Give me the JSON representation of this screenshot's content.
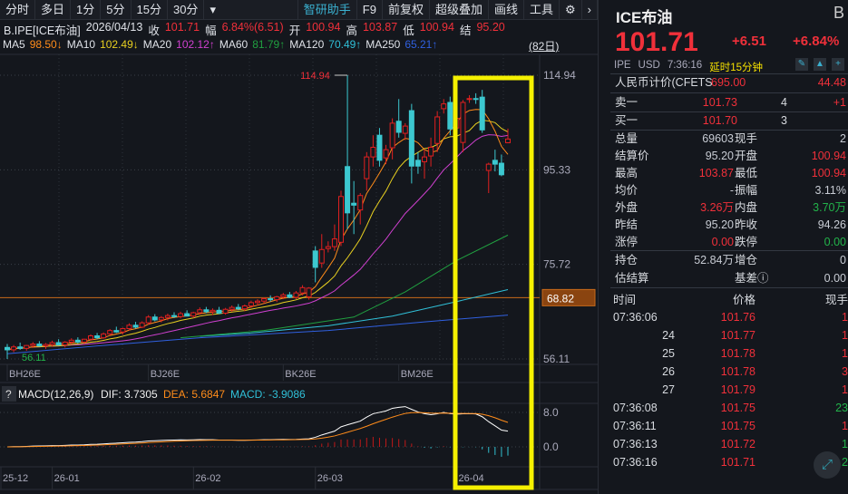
{
  "toolbar": {
    "tabs": [
      "分时",
      "多日",
      "1分",
      "5分",
      "15分",
      "30分"
    ],
    "dropdown": "▾",
    "assistant": "智研助手",
    "buttons": [
      "F9",
      "前复权",
      "超级叠加",
      "画线",
      "工具"
    ],
    "gear": "⚙",
    "next": "›"
  },
  "info": {
    "symbol": "B.IPE[ICE布油]",
    "date": "2026/04/13",
    "close_label": "收",
    "close": "101.71",
    "range_label": "幅",
    "range": "6.84%(6.51)",
    "open_label": "开",
    "open": "100.94",
    "high_label": "高",
    "high": "103.87",
    "low_label": "低",
    "low": "100.94",
    "settle_label": "结",
    "settle": "95.20"
  },
  "ma": [
    {
      "label": "MA5",
      "value": "98.50↓",
      "color": "#ff8c1a"
    },
    {
      "label": "MA10",
      "value": "102.49↓",
      "color": "#e8d020"
    },
    {
      "label": "MA20",
      "value": "102.12↑",
      "color": "#d040d0"
    },
    {
      "label": "MA60",
      "value": "81.79↑",
      "color": "#20a040"
    },
    {
      "label": "MA120",
      "value": "70.49↑",
      "color": "#30c0d8"
    },
    {
      "label": "MA250",
      "value": "65.21↑",
      "color": "#3060e0"
    }
  ],
  "days": "(82日)",
  "chart_data": {
    "type": "candlestick",
    "price_axis": {
      "ticks": [
        "114.94",
        "95.33",
        "75.72",
        "56.11"
      ],
      "range": [
        56.11,
        114.94
      ]
    },
    "max_label": "114.94",
    "min_label": "56.11",
    "ref_line": {
      "value": 68.82,
      "label": "68.82",
      "color": "#c86a1a"
    },
    "contract_labels": [
      {
        "label": "BH26E",
        "index": 0
      },
      {
        "label": "BJ26E",
        "index": 22
      },
      {
        "label": "BK26E",
        "index": 43
      },
      {
        "label": "BM26E",
        "index": 61
      }
    ],
    "date_labels": [
      {
        "label": "25-12",
        "index": 0
      },
      {
        "label": "26-01",
        "index": 8
      },
      {
        "label": "26-02",
        "index": 30
      },
      {
        "label": "26-03",
        "index": 49
      },
      {
        "label": "26-04",
        "index": 71
      }
    ],
    "up_color": "#e02020",
    "down_color": "#3cc8d0",
    "candles": [
      [
        58.5,
        59.2,
        56.11,
        58.0
      ],
      [
        58.0,
        59.0,
        57.5,
        58.6
      ],
      [
        58.6,
        59.5,
        58.0,
        58.3
      ],
      [
        58.3,
        59.0,
        57.8,
        58.9
      ],
      [
        58.9,
        59.6,
        58.4,
        59.2
      ],
      [
        59.2,
        59.8,
        58.7,
        58.8
      ],
      [
        58.8,
        59.4,
        58.2,
        59.1
      ],
      [
        59.1,
        59.9,
        58.6,
        59.5
      ],
      [
        59.5,
        60.2,
        59.0,
        59.0
      ],
      [
        59.0,
        59.8,
        58.5,
        59.6
      ],
      [
        59.6,
        60.4,
        59.1,
        60.0
      ],
      [
        60.0,
        60.6,
        59.3,
        59.6
      ],
      [
        59.6,
        60.3,
        59.2,
        60.2
      ],
      [
        60.2,
        61.2,
        59.9,
        60.9
      ],
      [
        60.9,
        61.5,
        60.2,
        60.5
      ],
      [
        60.5,
        61.6,
        60.3,
        61.3
      ],
      [
        61.3,
        62.3,
        61.0,
        62.0
      ],
      [
        62.0,
        62.8,
        61.5,
        61.7
      ],
      [
        61.7,
        62.6,
        61.2,
        62.4
      ],
      [
        62.4,
        63.5,
        62.0,
        63.1
      ],
      [
        63.1,
        63.8,
        62.4,
        62.7
      ],
      [
        62.7,
        63.9,
        62.5,
        63.6
      ],
      [
        63.6,
        65.2,
        63.2,
        64.8
      ],
      [
        64.8,
        65.4,
        63.9,
        64.2
      ],
      [
        64.2,
        65.0,
        63.7,
        64.7
      ],
      [
        64.7,
        65.5,
        64.1,
        65.1
      ],
      [
        65.1,
        65.8,
        64.6,
        64.9
      ],
      [
        64.9,
        65.9,
        64.5,
        65.5
      ],
      [
        65.5,
        66.2,
        64.9,
        65.0
      ],
      [
        65.0,
        65.9,
        64.6,
        65.7
      ],
      [
        65.7,
        66.8,
        65.3,
        66.3
      ],
      [
        66.3,
        66.9,
        65.6,
        65.9
      ],
      [
        65.9,
        66.6,
        65.2,
        66.2
      ],
      [
        66.2,
        66.9,
        65.4,
        65.6
      ],
      [
        65.6,
        66.7,
        65.3,
        66.4
      ],
      [
        66.4,
        67.2,
        65.9,
        66.8
      ],
      [
        66.8,
        67.5,
        66.2,
        66.5
      ],
      [
        66.5,
        67.4,
        66.0,
        67.1
      ],
      [
        67.1,
        68.2,
        66.7,
        67.8
      ],
      [
        67.8,
        68.5,
        67.2,
        68.1
      ],
      [
        68.1,
        68.9,
        67.6,
        68.6
      ],
      [
        68.6,
        69.3,
        68.0,
        68.4
      ],
      [
        68.4,
        69.2,
        67.9,
        69.0
      ],
      [
        69.0,
        69.8,
        68.5,
        69.4
      ],
      [
        69.4,
        70.0,
        68.7,
        68.9
      ],
      [
        68.9,
        70.2,
        68.5,
        69.8
      ],
      [
        69.8,
        71.4,
        69.3,
        70.9
      ],
      [
        69.0,
        71.0,
        68.4,
        70.8
      ],
      [
        78.5,
        79.5,
        72.0,
        75.1
      ],
      [
        76,
        82,
        75,
        78.8
      ],
      [
        79.0,
        80.5,
        78.2,
        79.4
      ],
      [
        79.4,
        84,
        78.5,
        81
      ],
      [
        80.3,
        91,
        79.5,
        89.8
      ],
      [
        96,
        114.94,
        83,
        86.4
      ],
      [
        88.4,
        93,
        82,
        88
      ],
      [
        87,
        90.5,
        84,
        90
      ],
      [
        93.5,
        99,
        91,
        98
      ],
      [
        98,
        102.5,
        96,
        100
      ],
      [
        102.5,
        104,
        96,
        97.3
      ],
      [
        97.8,
        100.5,
        96.5,
        99.5
      ],
      [
        99.9,
        106,
        97.5,
        105
      ],
      [
        105.4,
        110,
        102,
        103.1
      ],
      [
        102.9,
        105,
        101.5,
        104.4
      ],
      [
        107.6,
        109,
        92.5,
        96.1
      ],
      [
        97.3,
        99,
        94.5,
        96.1
      ],
      [
        97,
        99.5,
        93.5,
        98
      ],
      [
        98.2,
        102,
        96,
        100
      ],
      [
        100.8,
        107.5,
        99,
        106.3
      ],
      [
        108,
        110,
        107,
        109
      ],
      [
        109.3,
        110.5,
        102.5,
        103.8
      ],
      [
        104,
        108,
        101,
        106
      ],
      [
        101,
        109.8,
        99,
        109.3
      ],
      [
        110,
        110.8,
        109.2,
        110.1
      ],
      [
        110.1,
        111.2,
        109,
        110
      ],
      [
        110.4,
        111.9,
        103,
        103.6
      ],
      [
        95.2,
        96.8,
        90.5,
        96.5
      ],
      [
        97.3,
        99.5,
        95,
        96.5
      ],
      [
        96.7,
        98.5,
        94,
        94.3
      ],
      [
        100.94,
        103.87,
        100.94,
        101.71
      ]
    ],
    "ma_long": {
      "MA60": [
        [
          27,
          60.5
        ],
        [
          40,
          62
        ],
        [
          54,
          64.8
        ],
        [
          62,
          70
        ],
        [
          70,
          76.5
        ],
        [
          78,
          81.79
        ]
      ],
      "MA120": [
        [
          30,
          60.8
        ],
        [
          38,
          61.5
        ],
        [
          50,
          63
        ],
        [
          60,
          65
        ],
        [
          70,
          68
        ],
        [
          78,
          70.49
        ]
      ],
      "MA250": [
        [
          0,
          57.2
        ],
        [
          14,
          58.8
        ],
        [
          30,
          60.5
        ],
        [
          50,
          62
        ],
        [
          65,
          63.8
        ],
        [
          78,
          65.21
        ]
      ]
    },
    "macd": {
      "title": "MACD(12,26,9)",
      "dif_label": "DIF: 3.7305",
      "dea_label": "DEA: 5.6847",
      "macd_label": "MACD: -3.9086",
      "ticks": [
        "8.0",
        "0.0"
      ],
      "range": [
        -5,
        12
      ],
      "help": "?"
    }
  },
  "highlight_color": "#f5f000",
  "quote": {
    "name": "ICE布油",
    "badge": "B",
    "price": "101.71",
    "change": "+6.51",
    "change_pct": "+6.84%",
    "exchange": "IPE",
    "currency": "USD",
    "time": "7:36:16",
    "delay": "延时15分钟",
    "rmb_label": "人民币计价(CFETS",
    "rmb_value": "695.00",
    "rmb_right": "44.48",
    "ask_label": "卖一",
    "ask_price": "101.73",
    "ask_vol": "4",
    "ask_chg": "+1",
    "bid_label": "买一",
    "bid_price": "101.70",
    "bid_vol": "3",
    "stats": [
      [
        "总量",
        "69603",
        "",
        "现手",
        "2",
        ""
      ],
      [
        "结算价",
        "95.20",
        "",
        "开盘",
        "100.94",
        "red"
      ],
      [
        "最高",
        "103.87",
        "red",
        "最低",
        "100.94",
        "red"
      ],
      [
        "均价",
        "-",
        "",
        "振幅",
        "3.11%",
        ""
      ],
      [
        "外盘",
        "3.26万",
        "red",
        "内盘",
        "3.70万",
        "grn"
      ],
      [
        "昨结",
        "95.20",
        "",
        "昨收",
        "94.26",
        ""
      ],
      [
        "涨停",
        "0.00",
        "red",
        "跌停",
        "0.00",
        "grn"
      ]
    ],
    "stats2": [
      [
        "持仓",
        "52.84万",
        "",
        "增仓",
        "0",
        ""
      ],
      [
        "估结算",
        "",
        "",
        "基差ⓘ",
        "0.00",
        ""
      ]
    ]
  },
  "ticks": {
    "headers": [
      "时间",
      "价格",
      "现手"
    ],
    "rows": [
      [
        "07:36:06",
        "101.76",
        "1",
        "red"
      ],
      [
        "24",
        "101.77",
        "1",
        "red"
      ],
      [
        "25",
        "101.78",
        "1",
        "red"
      ],
      [
        "26",
        "101.78",
        "3",
        "red"
      ],
      [
        "27",
        "101.79",
        "1",
        "red"
      ],
      [
        "07:36:08",
        "101.75",
        "23",
        "grn"
      ],
      [
        "07:36:11",
        "101.75",
        "1",
        "red"
      ],
      [
        "07:36:13",
        "101.72",
        "1",
        "grn"
      ],
      [
        "07:36:16",
        "101.71",
        "2",
        "grn"
      ]
    ]
  }
}
